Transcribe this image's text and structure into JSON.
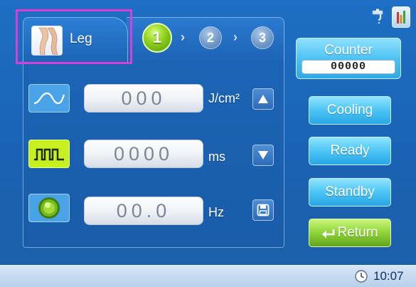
{
  "tab": {
    "label": "Leg"
  },
  "steps": {
    "step1": "1",
    "step2": "2",
    "step3": "3",
    "chevron": "›"
  },
  "rows": [
    {
      "value": "000",
      "unit": "J/cm²"
    },
    {
      "value": "0000",
      "unit": "ms"
    },
    {
      "value": "00.0",
      "unit": "Hz"
    }
  ],
  "counter": {
    "title": "Counter",
    "value": "00000"
  },
  "buttons": {
    "cooling": "Cooling",
    "ready": "Ready",
    "standby": "Standby",
    "return": "Return"
  },
  "status": {
    "time": "10:07"
  },
  "icons": {
    "tab": "leg-thumbnail-icon",
    "wave": "fluence-wave-icon",
    "pulse": "pulse-width-icon",
    "frequency": "frequency-icon",
    "up": "arrow-up-icon",
    "down": "arrow-down-icon",
    "save": "save-icon",
    "tap": "water-tap-icon",
    "level": "level-meter-icon",
    "clock": "clock-icon",
    "return": "return-arrow-icon"
  },
  "colors": {
    "background": "#1a62b3",
    "active_step": "#8fce1c",
    "blue_button": "#4cc5f5",
    "return_button": "#8fd43a",
    "highlight_box": "#d93fd6"
  }
}
